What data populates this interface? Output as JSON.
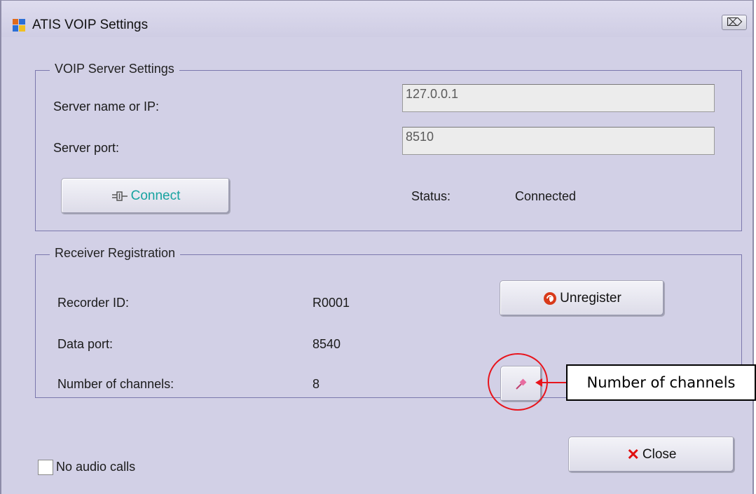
{
  "window": {
    "title": "ATIS VOIP Settings",
    "close_glyph": "⌦"
  },
  "server_group": {
    "title": "VOIP Server Settings",
    "server_label": "Server name or IP:",
    "server_value": "127.0.0.1",
    "port_label": "Server port:",
    "port_value": "8510",
    "connect_label": "Connect",
    "status_label": "Status:",
    "status_value": "Connected"
  },
  "registration_group": {
    "title": "Receiver Registration",
    "recorder_label": "Recorder ID:",
    "recorder_value": "R0001",
    "data_port_label": "Data port:",
    "data_port_value": "8540",
    "channels_label": "Number of channels:",
    "channels_value": "8",
    "unregister_label": "Unregister"
  },
  "no_audio_label": "No audio calls",
  "close_label": "Close",
  "annotation": {
    "text": "Number of channels"
  },
  "colors": {
    "window_bg": "#d2d0e6",
    "group_border": "#7b78ad",
    "connect_text": "#17a3a0",
    "close_x": "#e01010",
    "callout": "#e8141c"
  }
}
